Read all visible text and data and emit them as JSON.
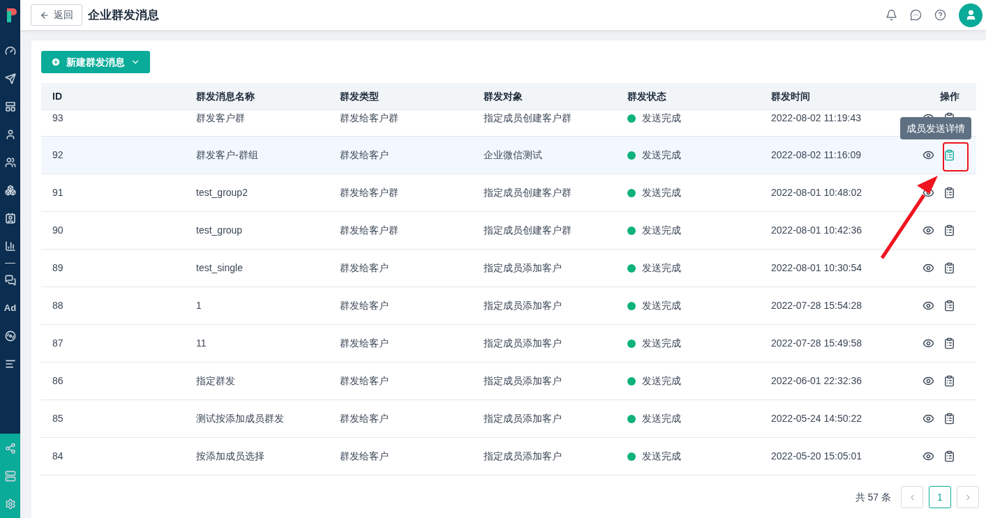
{
  "sidebar": {
    "ad_label": "Ad"
  },
  "header": {
    "back": "返回",
    "title": "企业群发消息"
  },
  "new_button": "新建群发消息",
  "table": {
    "columns": [
      "ID",
      "群发消息名称",
      "群发类型",
      "群发对象",
      "群发状态",
      "群发时间",
      "操作"
    ],
    "tooltip": "成员发送详情",
    "rows": [
      {
        "id": "93",
        "name": "群发客户群",
        "type": "群发给客户群",
        "target": "指定成员创建客户群",
        "status": "发送完成",
        "time": "2022-08-02 11:19:43",
        "hovered": false,
        "detail_active": false
      },
      {
        "id": "92",
        "name": "群发客户-群组",
        "type": "群发给客户",
        "target": "企业微信测试",
        "status": "发送完成",
        "time": "2022-08-02 11:16:09",
        "hovered": true,
        "detail_active": true
      },
      {
        "id": "91",
        "name": "test_group2",
        "type": "群发给客户群",
        "target": "指定成员创建客户群",
        "status": "发送完成",
        "time": "2022-08-01 10:48:02",
        "hovered": false,
        "detail_active": false
      },
      {
        "id": "90",
        "name": "test_group",
        "type": "群发给客户群",
        "target": "指定成员创建客户群",
        "status": "发送完成",
        "time": "2022-08-01 10:42:36",
        "hovered": false,
        "detail_active": false
      },
      {
        "id": "89",
        "name": "test_single",
        "type": "群发给客户",
        "target": "指定成员添加客户",
        "status": "发送完成",
        "time": "2022-08-01 10:30:54",
        "hovered": false,
        "detail_active": false
      },
      {
        "id": "88",
        "name": "1",
        "type": "群发给客户",
        "target": "指定成员添加客户",
        "status": "发送完成",
        "time": "2022-07-28 15:54:28",
        "hovered": false,
        "detail_active": false
      },
      {
        "id": "87",
        "name": "11",
        "type": "群发给客户",
        "target": "指定成员添加客户",
        "status": "发送完成",
        "time": "2022-07-28 15:49:58",
        "hovered": false,
        "detail_active": false
      },
      {
        "id": "86",
        "name": "指定群发",
        "type": "群发给客户",
        "target": "指定成员添加客户",
        "status": "发送完成",
        "time": "2022-06-01 22:32:36",
        "hovered": false,
        "detail_active": false
      },
      {
        "id": "85",
        "name": "测试按添加成员群发",
        "type": "群发给客户",
        "target": "指定成员添加客户",
        "status": "发送完成",
        "time": "2022-05-24 14:50:22",
        "hovered": false,
        "detail_active": false
      },
      {
        "id": "84",
        "name": "按添加成员选择",
        "type": "群发给客户",
        "target": "指定成员添加客户",
        "status": "发送完成",
        "time": "2022-05-20 15:05:01",
        "hovered": false,
        "detail_active": false
      }
    ]
  },
  "pagination": {
    "total": "共 57 条",
    "pages": [
      {
        "label": "1",
        "selected": true
      }
    ]
  }
}
